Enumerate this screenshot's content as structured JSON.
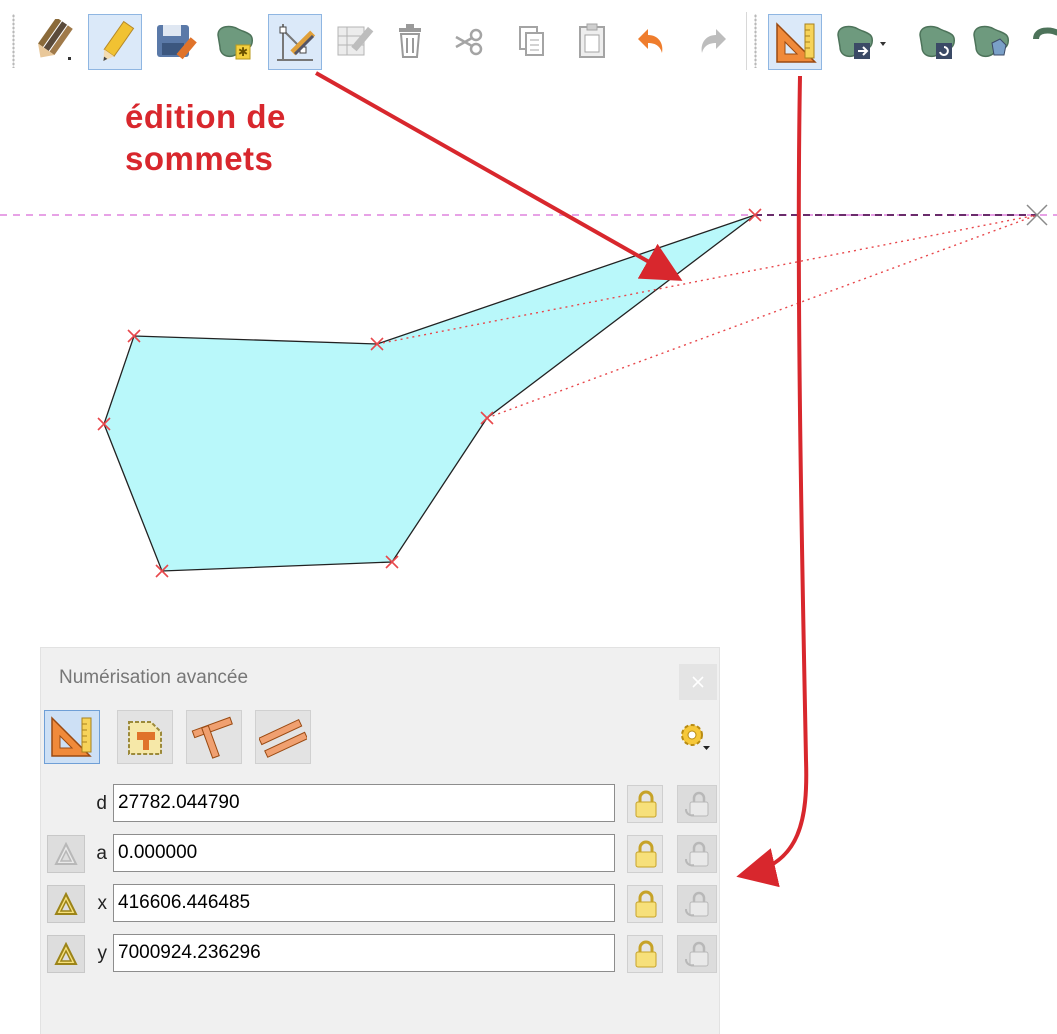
{
  "annotation": {
    "line1": "édition de",
    "line2": "sommets"
  },
  "toolbar": {
    "buttons": [
      {
        "name": "digitizing-pencils-dropdown",
        "icon": "pencils-icon",
        "active": false
      },
      {
        "name": "toggle-editing",
        "icon": "pencil-icon",
        "active": true
      },
      {
        "name": "save-layer-edits",
        "icon": "save-icon",
        "active": false
      },
      {
        "name": "add-polygon-feature",
        "icon": "add-polygon-icon",
        "active": false
      },
      {
        "name": "vertex-tool",
        "icon": "vertex-tool-icon",
        "active": true
      },
      {
        "name": "modify-attributes",
        "icon": "edit-table-icon",
        "active": false
      },
      {
        "name": "delete-selected",
        "icon": "trash-icon",
        "active": false
      },
      {
        "name": "cut-features",
        "icon": "scissors-icon",
        "active": false
      },
      {
        "name": "copy-features",
        "icon": "copy-icon",
        "active": false
      },
      {
        "name": "paste-features",
        "icon": "paste-icon",
        "active": false
      },
      {
        "name": "undo",
        "icon": "undo-icon",
        "active": false
      },
      {
        "name": "redo",
        "icon": "redo-icon",
        "active": false
      },
      {
        "name": "advanced-digitizing",
        "icon": "set-square-icon",
        "active": true
      },
      {
        "name": "move-feature",
        "icon": "move-feature-icon",
        "active": false
      },
      {
        "name": "rotate-feature",
        "icon": "rotate-feature-icon",
        "active": false
      },
      {
        "name": "simplify-feature",
        "icon": "simplify-icon",
        "active": false
      }
    ]
  },
  "panel": {
    "title": "Numérisation avancée",
    "close_icon": "close-icon",
    "tools": [
      {
        "name": "cad-enable",
        "icon": "set-square-icon",
        "active": true
      },
      {
        "name": "construction-mode",
        "icon": "construction-icon",
        "active": false
      },
      {
        "name": "perpendicular",
        "icon": "perpendicular-icon",
        "active": false
      },
      {
        "name": "parallel",
        "icon": "parallel-icon",
        "active": false
      }
    ],
    "settings_icon": "gear-icon",
    "fields": [
      {
        "label": "d",
        "value": "27782.044790",
        "relative": false
      },
      {
        "label": "a",
        "value": "0.000000",
        "relative": true,
        "relative_active": false
      },
      {
        "label": "x",
        "value": "416606.446485",
        "relative": true,
        "relative_active": true
      },
      {
        "label": "y",
        "value": "7000924.236296",
        "relative": true,
        "relative_active": true
      }
    ]
  },
  "colors": {
    "polygon_fill": "#b9f8fa",
    "vertex_marker": "#e8484c",
    "annotation": "#d8272d",
    "guide_line": "#e7a2e6"
  }
}
